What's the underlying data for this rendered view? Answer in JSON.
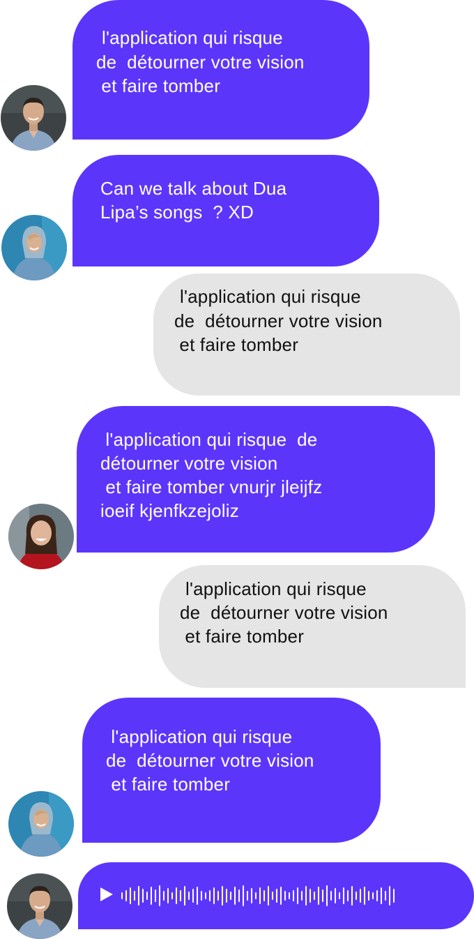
{
  "colors": {
    "incoming_bubble": "#5c35fb",
    "outgoing_bubble": "#e5e5e5",
    "incoming_text": "#ffffff",
    "outgoing_text": "#111111"
  },
  "messages": [
    {
      "direction": "incoming",
      "avatar": "man-avatar",
      "lines": [
        "l'application qui risque",
        "de  détourner votre vision",
        " et faire tomber"
      ]
    },
    {
      "direction": "incoming",
      "avatar": "hooded-woman-avatar",
      "lines": [
        "Can we talk about Dua",
        "Lipa’s songs  ? XD"
      ]
    },
    {
      "direction": "outgoing",
      "lines": [
        "l'application qui risque",
        "de  détourner votre vision",
        " et faire tomber"
      ]
    },
    {
      "direction": "incoming",
      "avatar": "smiling-woman-avatar",
      "lines": [
        " l'application qui risque  de",
        "détourner votre vision",
        " et faire tomber vnurjr jleijfz",
        "ioeif kjenfkzejoliz"
      ]
    },
    {
      "direction": "outgoing",
      "lines": [
        "l'application qui risque",
        "de  détourner votre vision",
        " et faire tomber"
      ]
    },
    {
      "direction": "incoming",
      "avatar": "hooded-woman-avatar",
      "lines": [
        " l'application qui risque",
        "de  détourner votre vision",
        " et faire tomber"
      ]
    },
    {
      "direction": "incoming",
      "avatar": "man-avatar",
      "type": "voice",
      "icon": "play-icon"
    }
  ]
}
